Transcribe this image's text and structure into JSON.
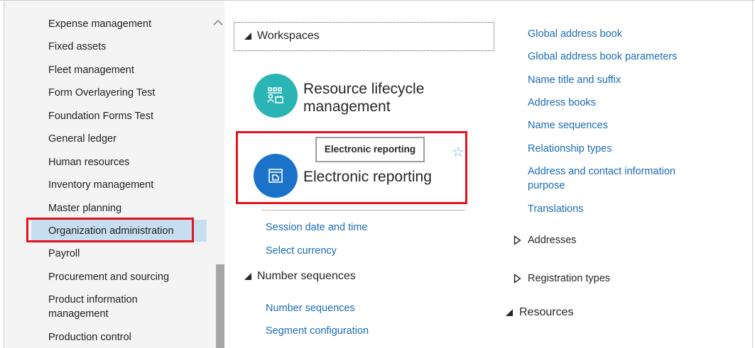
{
  "sidebar": {
    "items": [
      {
        "label": "Expense management"
      },
      {
        "label": "Fixed assets"
      },
      {
        "label": "Fleet management"
      },
      {
        "label": "Form Overlayering Test"
      },
      {
        "label": "Foundation Forms Test"
      },
      {
        "label": "General ledger"
      },
      {
        "label": "Human resources"
      },
      {
        "label": "Inventory management"
      },
      {
        "label": "Master planning"
      },
      {
        "label": "Organization administration",
        "selected": true
      },
      {
        "label": "Payroll"
      },
      {
        "label": "Procurement and sourcing"
      },
      {
        "label": "Product information management"
      },
      {
        "label": "Production control"
      }
    ]
  },
  "workspaces": {
    "title": "Workspaces",
    "tiles": [
      {
        "label": "Resource lifecycle management",
        "icon": "resource-lifecycle-icon",
        "color": "#2ab5b4"
      },
      {
        "label": "Electronic reporting",
        "icon": "electronic-reporting-icon",
        "color": "#1a73c9"
      }
    ],
    "tooltip": "Electronic reporting"
  },
  "setup_links": [
    {
      "label": "Session date and time"
    },
    {
      "label": "Select currency"
    }
  ],
  "number_sequences": {
    "title": "Number sequences",
    "links": [
      {
        "label": "Number sequences"
      },
      {
        "label": "Segment configuration"
      }
    ]
  },
  "global_address_book": {
    "links": [
      {
        "label": "Global address book"
      },
      {
        "label": "Global address book parameters"
      },
      {
        "label": "Name title and suffix"
      },
      {
        "label": "Address books"
      },
      {
        "label": "Name sequences"
      },
      {
        "label": "Relationship types"
      },
      {
        "label": "Address and contact information purpose"
      },
      {
        "label": "Translations"
      }
    ],
    "groups": [
      {
        "label": "Addresses"
      },
      {
        "label": "Registration types"
      }
    ]
  },
  "resources": {
    "title": "Resources"
  },
  "colors": {
    "link": "#1a6cb6",
    "highlight": "#e3121c",
    "selected": "#c7def1"
  }
}
